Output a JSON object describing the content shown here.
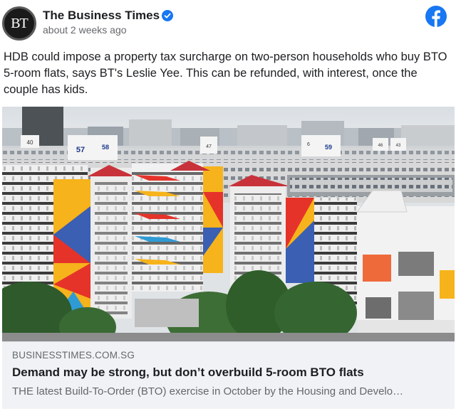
{
  "post": {
    "avatar_text": "BT",
    "page_name": "The Business Times",
    "timestamp": "about 2 weeks ago",
    "caption": "HDB could impose a property tax surcharge on two-person households who buy BTO 5-room flats, says BT's Leslie Yee. This can be refunded, with interest, once the couple has kids."
  },
  "photo": {
    "block_numbers": [
      "40",
      "57",
      "58",
      "47",
      "6",
      "59",
      "46",
      "43"
    ]
  },
  "link_preview": {
    "domain": "BUSINESSTIMES.COM.SG",
    "title": "Demand may be strong, but don’t overbuild 5-room BTO flats",
    "description": "THE latest Build-To-Order (BTO) exercise in October by the Housing and Develo…"
  },
  "colors": {
    "facebook_blue": "#1877f2",
    "verified_blue": "#1877f2",
    "link_bg": "#f0f2f5"
  }
}
